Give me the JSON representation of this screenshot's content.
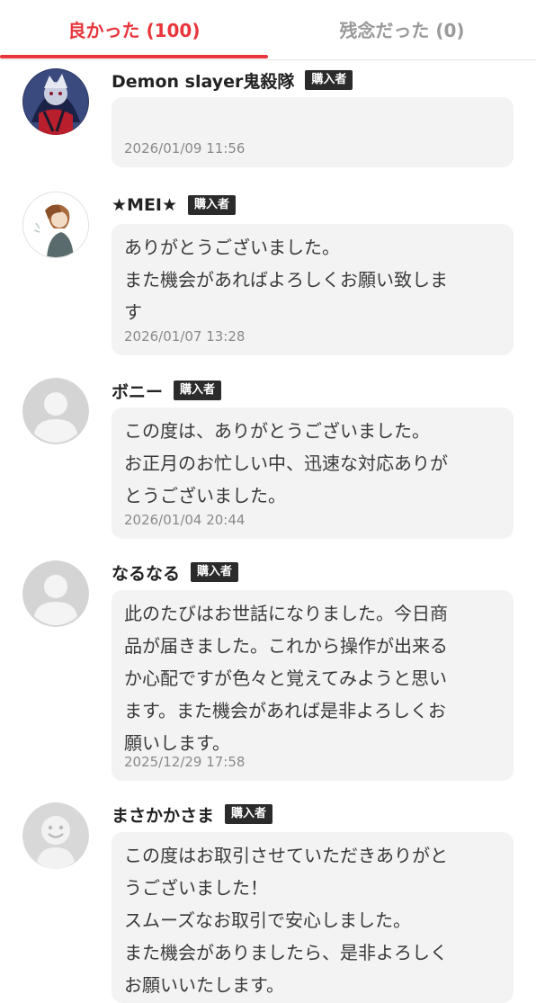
{
  "tabs": {
    "good_label": "良かった (100)",
    "bad_label": "残念だった (0)"
  },
  "badge_label": "購入者",
  "reviews": [
    {
      "name": "Demon slayer鬼殺隊",
      "comment": "",
      "date": "2026/01/09 11:56",
      "avatar": "anime-character-avatar"
    },
    {
      "name": "★MEI★",
      "comment": "ありがとうございました。\nまた機会があればよろしくお願い致しま\nす",
      "date": "2026/01/07 13:28",
      "avatar": "illustrated-woman-avatar"
    },
    {
      "name": "ボニー",
      "comment": "この度は、ありがとうございました。\nお正月のお忙しい中、迅速な対応ありが\nとうございました。",
      "date": "2026/01/04 20:44",
      "avatar": "default-user-avatar"
    },
    {
      "name": "なるなる",
      "comment": "此のたびはお世話になりました。今日商\n品が届きました。これから操作が出来る\nか心配ですが色々と覚えてみようと思い\nます。また機会があれば是非よろしくお\n願いします。",
      "date": "2025/12/29 17:58",
      "avatar": "default-user-avatar"
    },
    {
      "name": "まさかかさま",
      "comment": "この度はお取引させていただきありがと\nうございました！\nスムーズなお取引で安心しました。\nまた機会がありましたら、是非よろしく\nお願いいたします。",
      "date": "",
      "avatar": "smiley-face-avatar"
    }
  ]
}
